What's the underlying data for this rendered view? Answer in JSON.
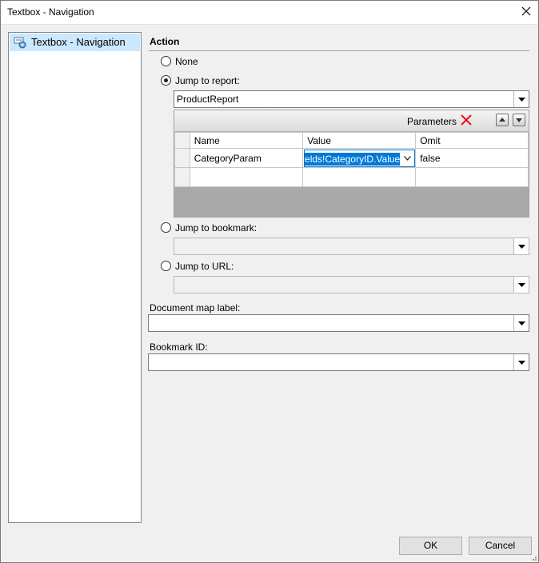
{
  "window": {
    "title": "Textbox - Navigation"
  },
  "tree": {
    "items": [
      {
        "label": "Textbox - Navigation"
      }
    ]
  },
  "action": {
    "heading": "Action",
    "none_label": "None",
    "jump_report_label": "Jump to report:",
    "report_value": "ProductReport",
    "parameters": {
      "caption": "Parameters",
      "columns": [
        "Name",
        "Value",
        "Omit"
      ],
      "rows": [
        {
          "name": "CategoryParam",
          "value": "=Fields!CategoryID.Value",
          "omit": "false"
        }
      ]
    },
    "jump_bookmark_label": "Jump to bookmark:",
    "bookmark_value": "",
    "jump_url_label": "Jump to URL:",
    "url_value": ""
  },
  "document_map": {
    "label": "Document map label:",
    "value": ""
  },
  "bookmark_id": {
    "label": "Bookmark ID:",
    "value": ""
  },
  "buttons": {
    "ok": "OK",
    "cancel": "Cancel"
  },
  "colors": {
    "accent": "#0078d7",
    "selection_bg": "#cce8ff",
    "delete_icon": "#e81123"
  }
}
